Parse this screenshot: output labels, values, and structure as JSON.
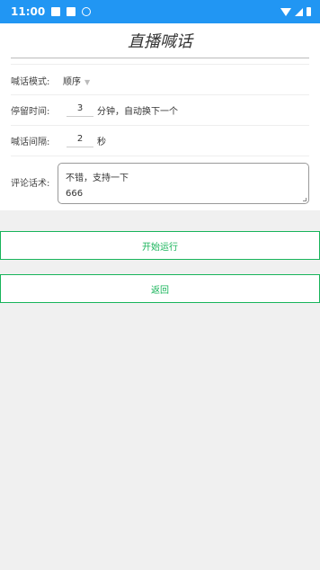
{
  "status_bar": {
    "time": "11:00",
    "icons": [
      "notification-icon",
      "a-icon",
      "sync-icon"
    ],
    "right_icons": [
      "wifi-icon",
      "signal-icon",
      "battery-icon"
    ],
    "background": "#2196f3"
  },
  "header": {
    "title": "直播喊话"
  },
  "form": {
    "mode": {
      "label": "喊话模式:",
      "value": "顺序"
    },
    "stay": {
      "label": "停留时间:",
      "value": "3",
      "suffix": "分钟，自动换下一个"
    },
    "interval": {
      "label": "喊话间隔:",
      "value": "2",
      "suffix": "秒"
    },
    "comments": {
      "label": "评论话术:",
      "lines": [
        "不错，支持一下",
        "666"
      ]
    }
  },
  "buttons": {
    "start": "开始运行",
    "back": "返回",
    "accent": "#18b45a"
  }
}
